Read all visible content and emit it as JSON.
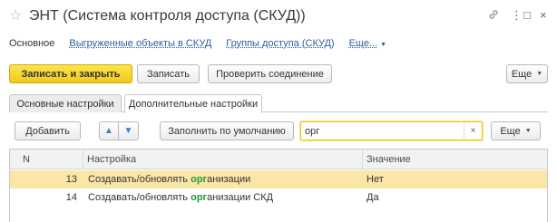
{
  "window": {
    "title": "ЭНТ (Система контроля доступа (СКУД))",
    "star": "☆",
    "link_icon": "🔗",
    "menu_icon": "⋮",
    "maximize_icon": "□",
    "close_icon": "×"
  },
  "nav": {
    "tabs": [
      {
        "label": "Основное"
      },
      {
        "label": "Выгруженные объекты в СКУД"
      },
      {
        "label": "Группы доступа (СКУД)"
      },
      {
        "label": "Еще..."
      }
    ]
  },
  "toolbar": {
    "save_close": "Записать и закрыть",
    "save": "Записать",
    "check_connection": "Проверить соединение",
    "more": "Еще"
  },
  "form_tabs": {
    "basic": "Основные настройки",
    "extra": "Дополнительные настройки"
  },
  "table_toolbar": {
    "add": "Добавить",
    "fill_default": "Заполнить по умолчанию",
    "search_value": "орг",
    "more": "Еще"
  },
  "table": {
    "columns": [
      "N",
      "Настройка",
      "Значение"
    ],
    "rows": [
      {
        "n": "13",
        "pre": "Создавать/обновлять ",
        "match": "орг",
        "post": "анизации",
        "value": "Нет",
        "selected": true
      },
      {
        "n": "14",
        "pre": "Создавать/обновлять ",
        "match": "орг",
        "post": "анизации СКД",
        "value": "Да",
        "selected": false
      }
    ]
  }
}
